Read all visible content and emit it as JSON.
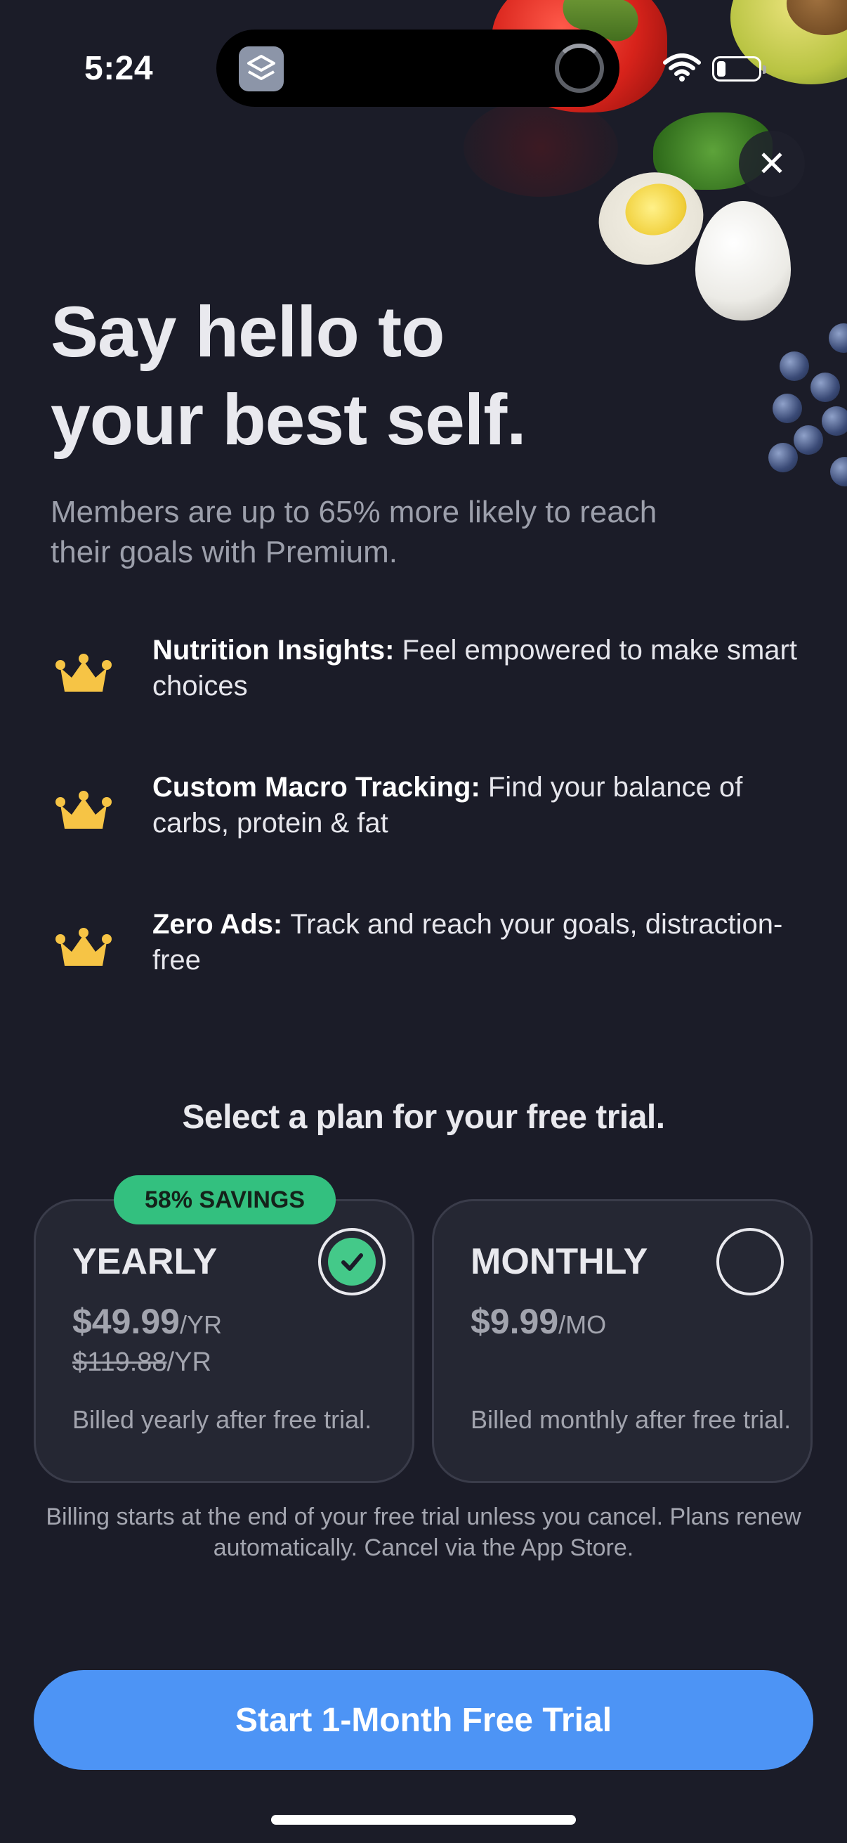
{
  "status_bar": {
    "time": "5:24"
  },
  "hero": {
    "headline_line1": "Say hello to",
    "headline_line2": "your best self.",
    "subhead": "Members are up to 65% more likely to reach their goals with Premium."
  },
  "features": [
    {
      "icon": "crown-icon",
      "title": "Nutrition Insights:",
      "text": "Feel empowered to make smart choices"
    },
    {
      "icon": "crown-icon",
      "title": "Custom Macro Tracking:",
      "text": "Find your balance of carbs, protein & fat"
    },
    {
      "icon": "crown-icon",
      "title": "Zero Ads:",
      "text": "Track and reach your goals, distraction-free"
    }
  ],
  "plans": {
    "title": "Select a plan for your free trial.",
    "savings_badge": "58% SAVINGS",
    "yearly": {
      "name": "YEARLY",
      "price": "$49.99",
      "price_unit": "/YR",
      "old_price": "$119.88",
      "old_unit": "/YR",
      "billed": "Billed yearly after free trial.",
      "selected": true
    },
    "monthly": {
      "name": "MONTHLY",
      "price": "$9.99",
      "price_unit": "/MO",
      "billed": "Billed monthly after free trial.",
      "selected": false
    }
  },
  "disclaimer": "Billing starts at the end of your free trial unless you cancel. Plans renew automatically. Cancel via the App Store.",
  "cta": {
    "label": "Start 1-Month Free Trial"
  },
  "colors": {
    "background": "#1b1c28",
    "accent_blue": "#4d94f5",
    "savings_green": "#33c07f",
    "crown_gold": "#f6c445"
  }
}
